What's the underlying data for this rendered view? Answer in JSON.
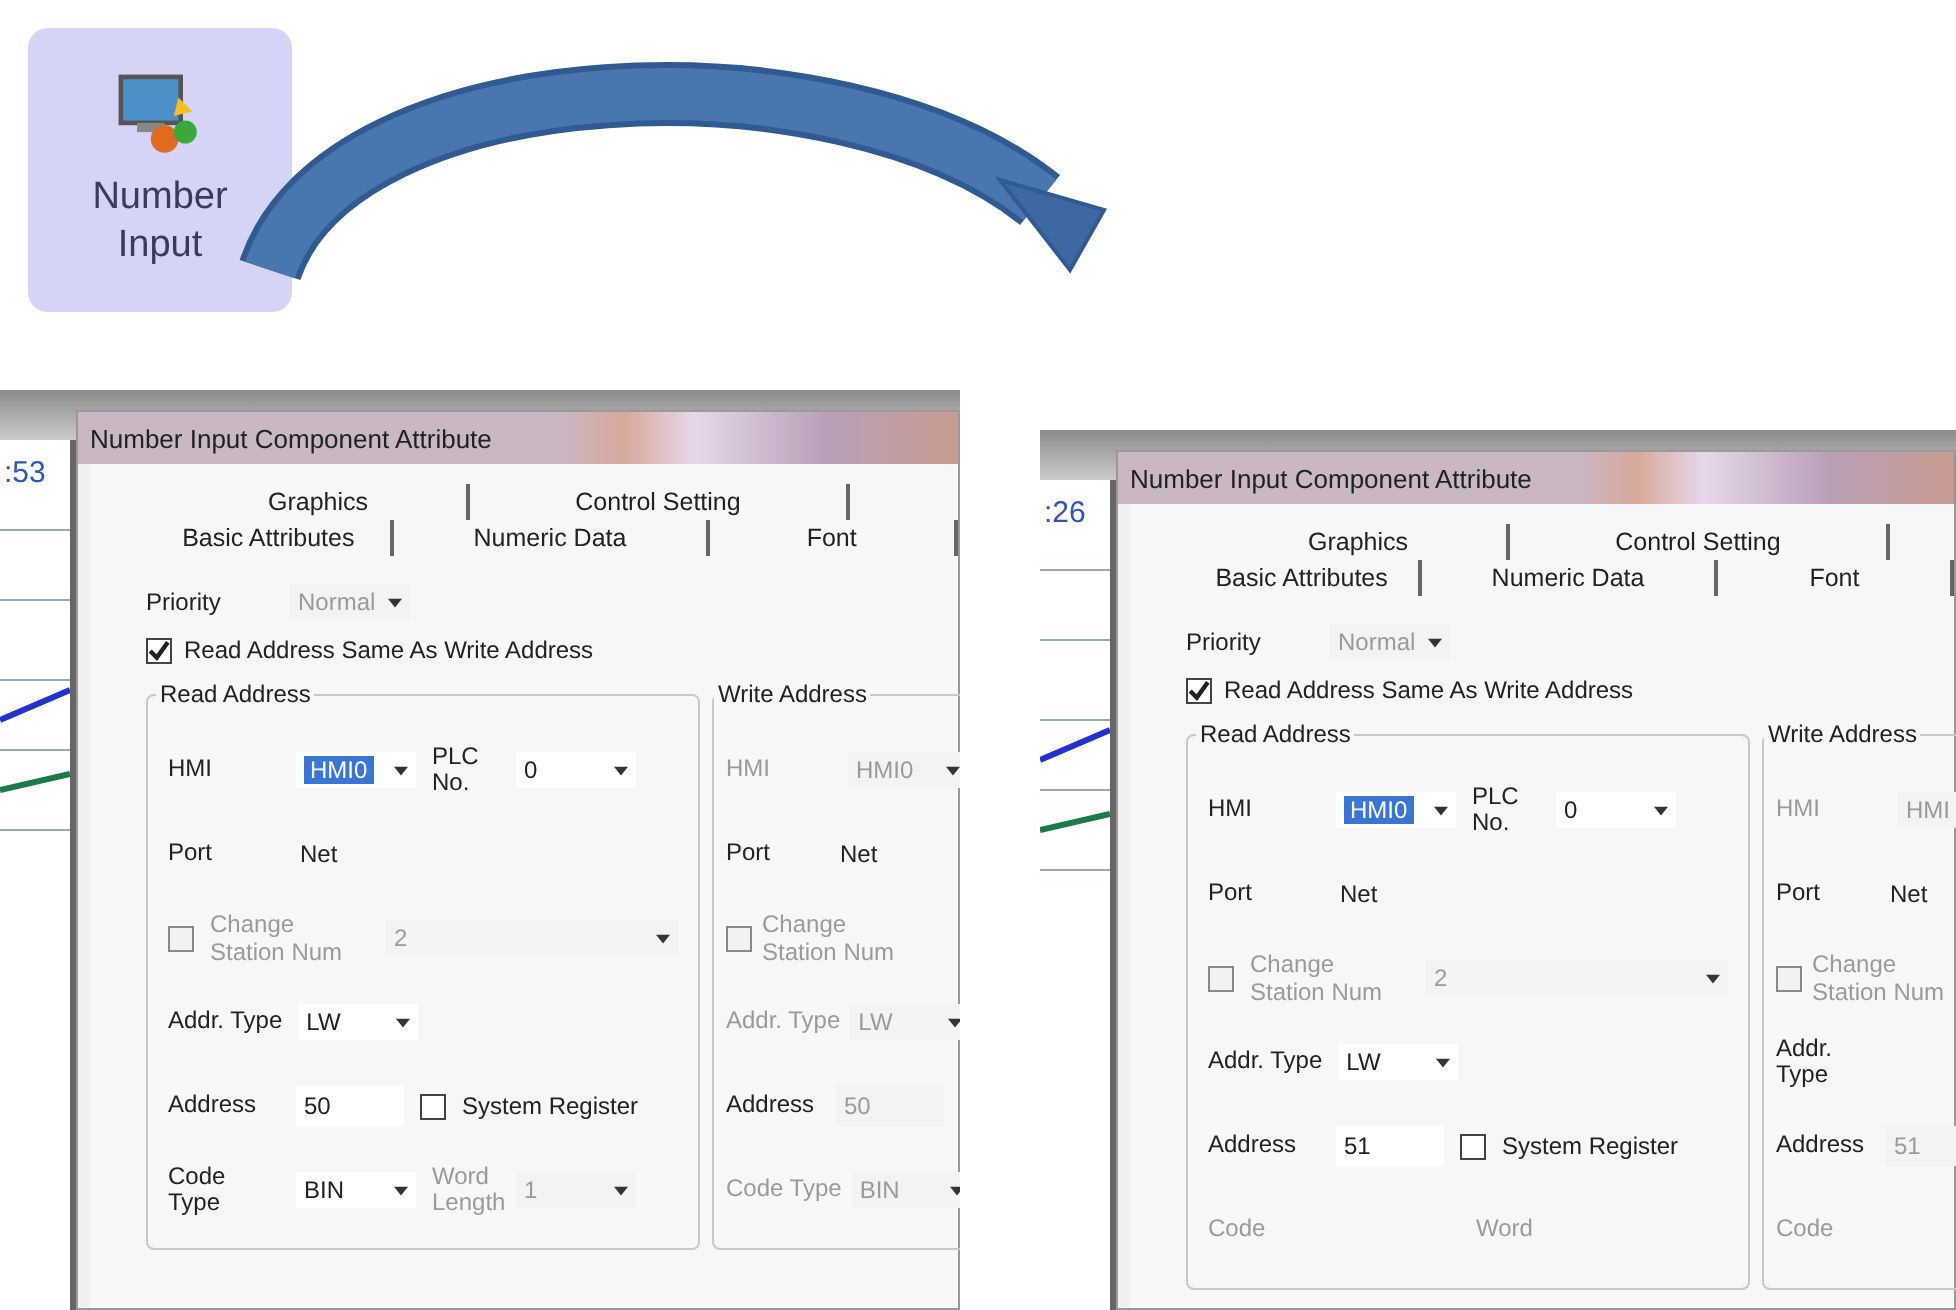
{
  "toolbar_button": {
    "label": "Number Input"
  },
  "dialogs": [
    {
      "background_text": ":53",
      "title": "Number Input Component Attribute",
      "tab_rows": [
        [
          {
            "label": "Graphics"
          },
          {
            "label": "Control Setting"
          }
        ],
        [
          {
            "label": "Basic Attributes"
          },
          {
            "label": "Numeric Data"
          },
          {
            "label": "Font"
          }
        ]
      ],
      "priority": {
        "label": "Priority",
        "value": "Normal",
        "disabled": true
      },
      "same_address": {
        "label": "Read Address Same As Write Address",
        "checked": true
      },
      "groups": [
        {
          "title": "Read Address",
          "rows": [
            [
              {
                "kind": "combo",
                "label": "HMI",
                "value": "HMI0",
                "disabled": false,
                "selected": true
              },
              {
                "kind": "combo",
                "label": "PLC No.",
                "value": "0",
                "disabled": false,
                "selected": false
              }
            ],
            [
              {
                "kind": "static",
                "label": "Port",
                "value": "Net",
                "disabled": false
              }
            ],
            [
              {
                "kind": "checkcombo",
                "label": "Change Station Num",
                "value": "2",
                "checked": false,
                "disabled": true
              }
            ],
            [
              {
                "kind": "combo",
                "label": "Addr. Type",
                "value": "LW",
                "disabled": false,
                "selected": false
              }
            ],
            [
              {
                "kind": "input",
                "label": "Address",
                "value": "50",
                "disabled": false
              },
              {
                "kind": "check",
                "label": "System Register",
                "checked": false,
                "disabled": false
              }
            ],
            [
              {
                "kind": "combo",
                "label": "Code Type",
                "value": "BIN",
                "disabled": false,
                "selected": false
              },
              {
                "kind": "combo",
                "label": "Word Length",
                "value": "1",
                "disabled": true,
                "selected": false
              }
            ]
          ]
        },
        {
          "title": "Write Address",
          "rows": [
            [
              {
                "kind": "combo",
                "label": "HMI",
                "value": "HMI0",
                "disabled": true
              }
            ],
            [
              {
                "kind": "static",
                "label": "Port",
                "value": "Net",
                "disabled": false
              }
            ],
            [
              {
                "kind": "check",
                "label": "Change Station Num",
                "checked": false,
                "disabled": true
              }
            ],
            [
              {
                "kind": "combo",
                "label": "Addr. Type",
                "value": "LW",
                "disabled": true
              }
            ],
            [
              {
                "kind": "input",
                "label": "Address",
                "value": "50",
                "disabled": true
              }
            ],
            [
              {
                "kind": "combo",
                "label": "Code Type",
                "value": "BIN",
                "disabled": true
              }
            ]
          ]
        }
      ]
    },
    {
      "background_text": ":26",
      "title": "Number Input Component Attribute",
      "tab_rows": [
        [
          {
            "label": "Graphics"
          },
          {
            "label": "Control Setting"
          }
        ],
        [
          {
            "label": "Basic Attributes"
          },
          {
            "label": "Numeric Data"
          },
          {
            "label": "Font"
          }
        ]
      ],
      "priority": {
        "label": "Priority",
        "value": "Normal",
        "disabled": true
      },
      "same_address": {
        "label": "Read Address Same As Write Address",
        "checked": true
      },
      "groups": [
        {
          "title": "Read Address",
          "rows": [
            [
              {
                "kind": "combo",
                "label": "HMI",
                "value": "HMI0",
                "disabled": false,
                "selected": true
              },
              {
                "kind": "combo",
                "label": "PLC No.",
                "value": "0",
                "disabled": false,
                "selected": false
              }
            ],
            [
              {
                "kind": "static",
                "label": "Port",
                "value": "Net",
                "disabled": false
              }
            ],
            [
              {
                "kind": "checkcombo",
                "label": "Change Station Num",
                "value": "2",
                "checked": false,
                "disabled": true
              }
            ],
            [
              {
                "kind": "combo",
                "label": "Addr. Type",
                "value": "LW",
                "disabled": false,
                "selected": false
              }
            ],
            [
              {
                "kind": "input",
                "label": "Address",
                "value": "51",
                "disabled": false
              },
              {
                "kind": "check",
                "label": "System Register",
                "checked": false,
                "disabled": false
              }
            ],
            [
              {
                "kind": "static",
                "label": "Code",
                "disabled": true
              },
              {
                "kind": "static",
                "label": "Word",
                "disabled": true
              }
            ]
          ]
        },
        {
          "title": "Write Address",
          "rows": [
            [
              {
                "kind": "combo",
                "label": "HMI",
                "value": "HMI",
                "disabled": true
              }
            ],
            [
              {
                "kind": "static",
                "label": "Port",
                "value": "Net",
                "disabled": false
              }
            ],
            [
              {
                "kind": "check",
                "label": "Change Station Num",
                "checked": false,
                "disabled": true
              }
            ],
            [
              {
                "kind": "static",
                "label": "Addr. Type",
                "disabled": false
              }
            ],
            [
              {
                "kind": "input",
                "label": "Address",
                "value": "51",
                "disabled": true
              }
            ],
            [
              {
                "kind": "static",
                "label": "Code",
                "disabled": true
              }
            ]
          ]
        }
      ]
    }
  ]
}
